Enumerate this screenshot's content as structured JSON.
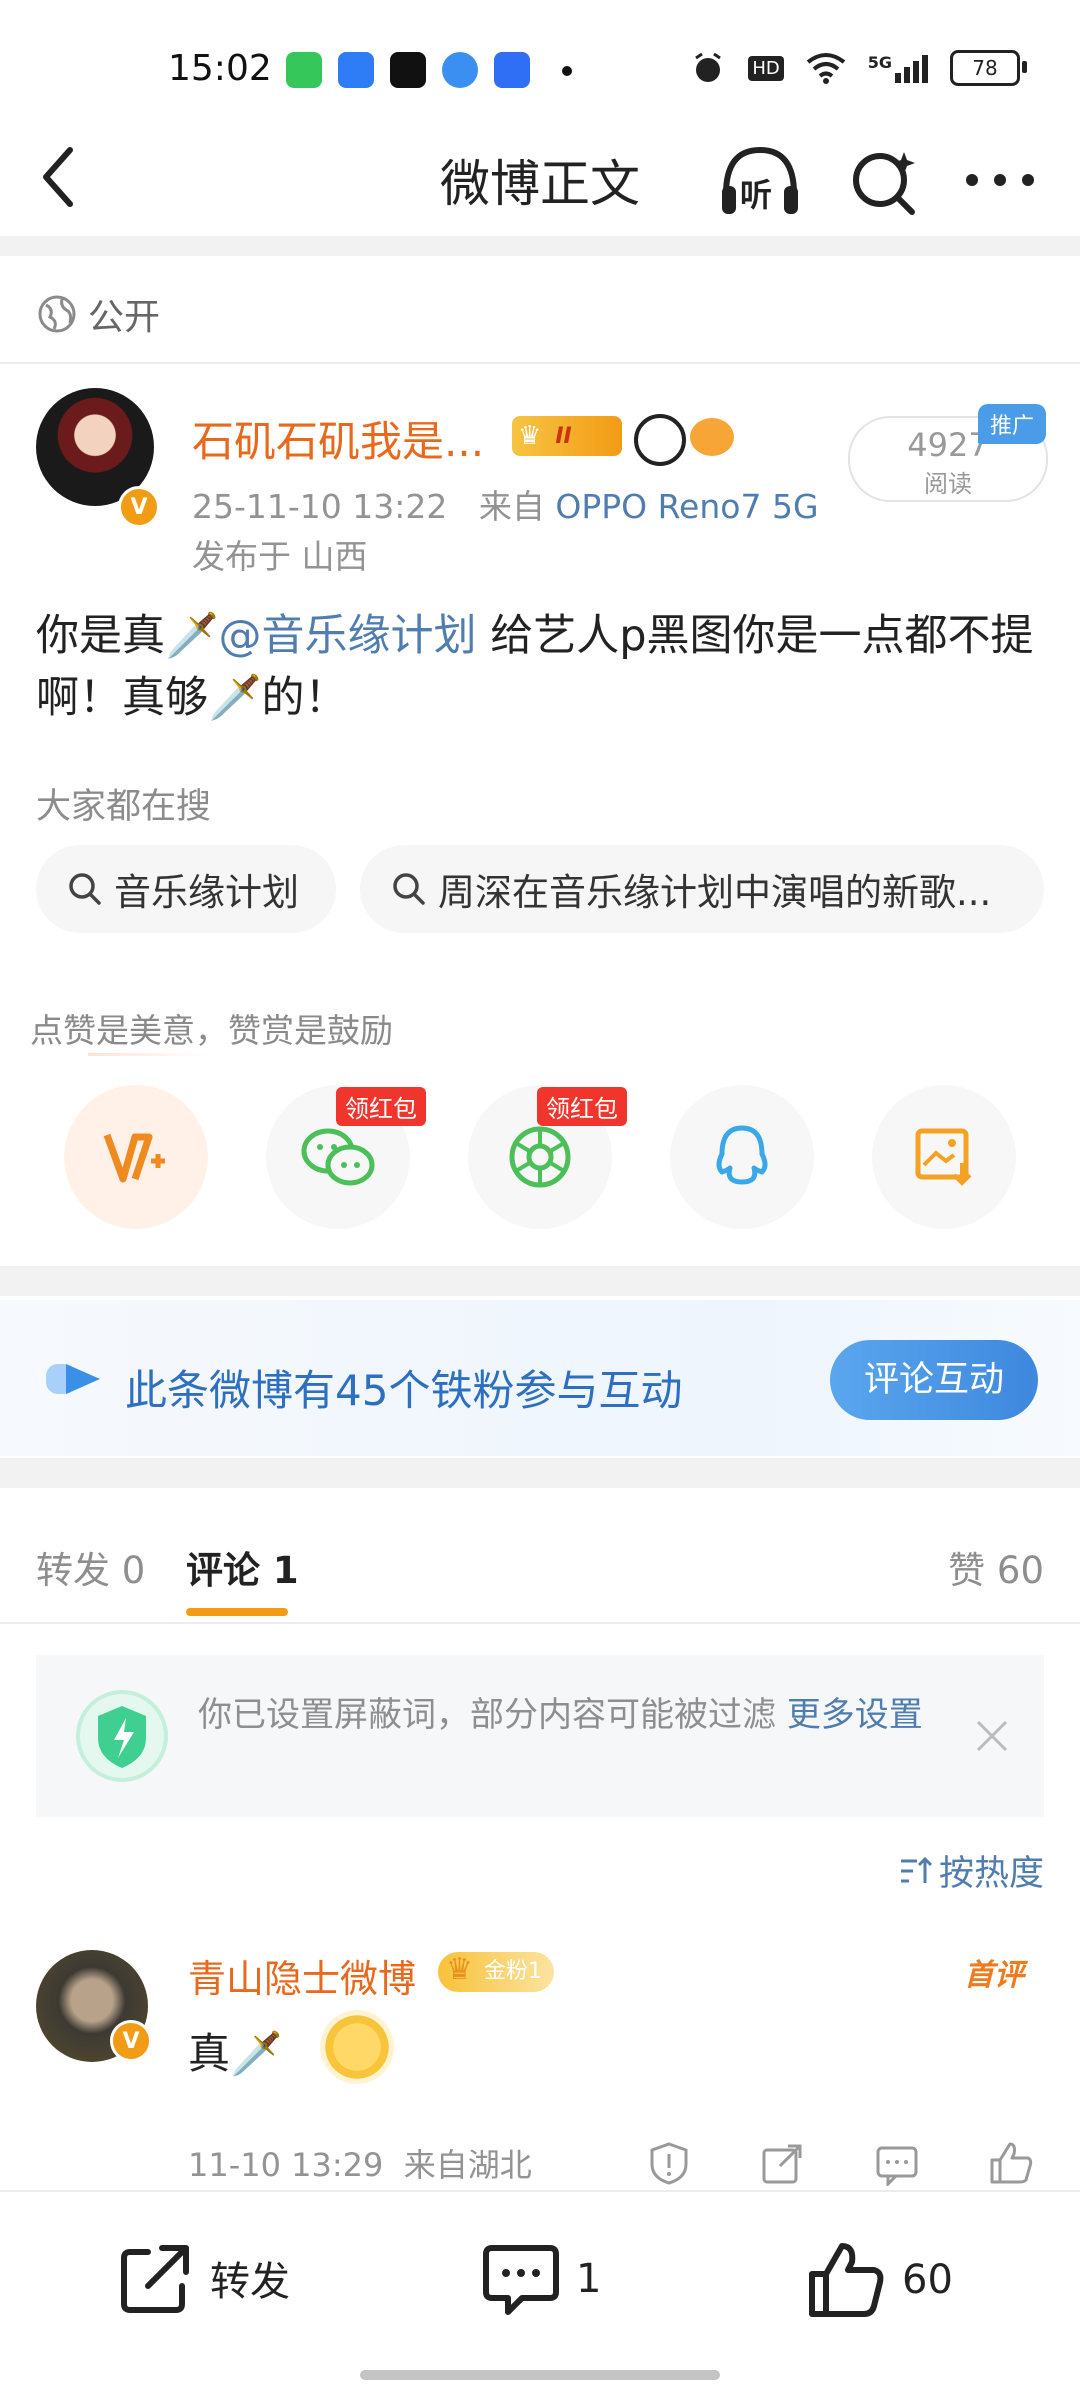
{
  "status_bar": {
    "time": "15:02",
    "hd": "HD",
    "network": "5G",
    "battery": "78"
  },
  "nav": {
    "title": "微博正文",
    "listen_label": "听"
  },
  "post": {
    "visibility": "公开",
    "author": {
      "name": "石矶石矶我是...",
      "level_badge": "II"
    },
    "date": "25-11-10 13:22",
    "source_prefix": "来自",
    "device": "OPPO Reno7 5G",
    "location": "发布于 山西",
    "read_count": "4927",
    "read_label": "阅读",
    "promo_tag": "推广",
    "text_before": "你是真🗡️",
    "mention": "@音乐缘计划",
    "text_after": " 给艺人p黑图你是一点都不提啊！真够🗡️的！"
  },
  "search": {
    "title": "大家都在搜",
    "chips": [
      "音乐缘计划",
      "周深在音乐缘计划中演唱的新歌..."
    ]
  },
  "share": {
    "tip": "点赞是美意，赞赏是鼓励",
    "red_packet_label": "领红包",
    "icons": [
      "weibo-reward-icon",
      "wechat-icon",
      "moments-icon",
      "qq-icon",
      "save-image-icon"
    ]
  },
  "fans_banner": {
    "text": "此条微博有45个铁粉参与互动",
    "button": "评论互动"
  },
  "tabs": {
    "repost": "转发 0",
    "comments": "评论 1",
    "likes": "赞 60"
  },
  "filter_notice": {
    "text": "你已设置屏蔽词，部分内容可能被过滤",
    "link": "更多设置"
  },
  "sort_label": "按热度",
  "comment": {
    "name": "青山隐士微博",
    "fan_badge": "金粉1",
    "first_tag": "首评",
    "text": "真🗡️",
    "time": "11-10 13:29",
    "location": "来自湖北"
  },
  "bottom_bar": {
    "repost": "转发",
    "comments": "1",
    "likes": "60"
  },
  "colors": {
    "accent_orange": "#f29b14",
    "link_blue": "#507daf",
    "name_orange": "#e8691c",
    "red_tag": "#f0352d"
  }
}
